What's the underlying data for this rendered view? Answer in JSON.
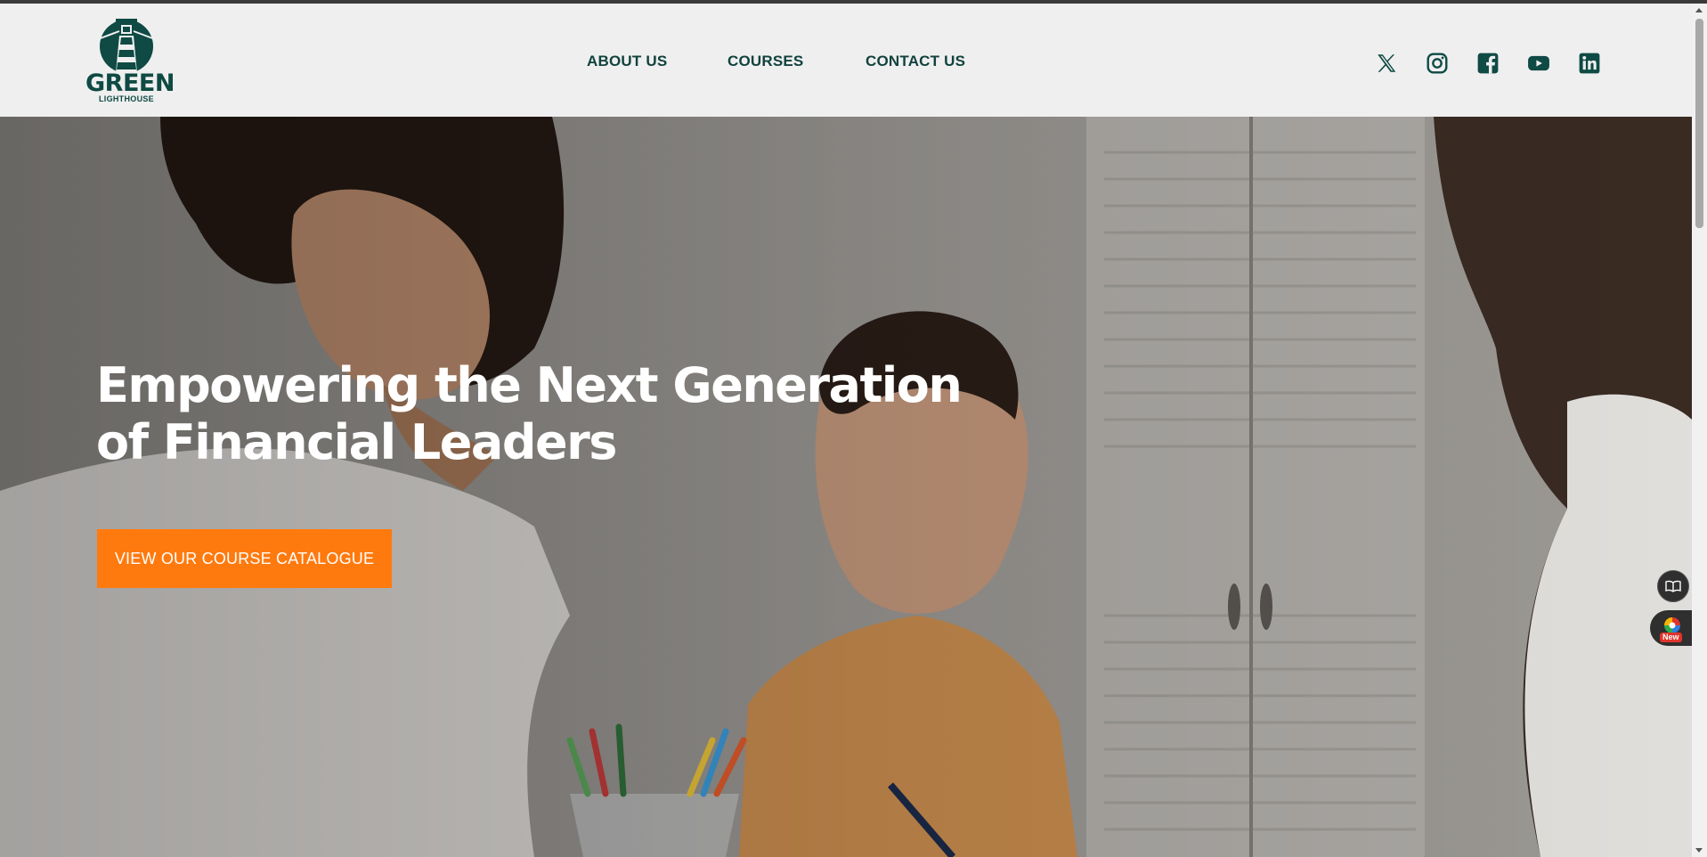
{
  "brand": {
    "name": "GREEN",
    "subtitle": "LIGHTHOUSE",
    "color": "#0f4a44"
  },
  "nav": {
    "items": [
      {
        "label": "ABOUT US"
      },
      {
        "label": "COURSES"
      },
      {
        "label": "CONTACT US"
      }
    ]
  },
  "social": {
    "icons": [
      "x-icon",
      "instagram-icon",
      "facebook-icon",
      "youtube-icon",
      "linkedin-icon"
    ],
    "color": "#0f4a44"
  },
  "hero": {
    "headline": "Empowering the Next Generation of Financial Leaders",
    "cta_label": "VIEW OUR COURSE CATALOGUE",
    "cta_color": "#ff7a0e"
  },
  "widgets": {
    "extension_badge": "New"
  }
}
